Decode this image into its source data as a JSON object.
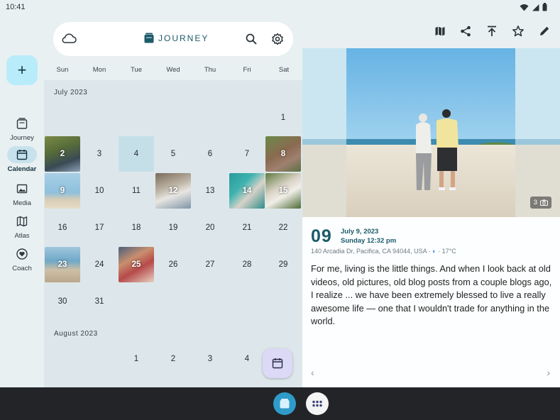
{
  "status": {
    "time": "10:41"
  },
  "rail": {
    "add_label": "+",
    "items": [
      {
        "label": "Journey",
        "icon": "journey-icon"
      },
      {
        "label": "Calendar",
        "icon": "calendar-icon",
        "active": true
      },
      {
        "label": "Media",
        "icon": "media-icon"
      },
      {
        "label": "Atlas",
        "icon": "map-icon"
      },
      {
        "label": "Coach",
        "icon": "coach-icon"
      }
    ]
  },
  "search_bar": {
    "brand": "JOURNEY"
  },
  "weekdays": [
    "Sun",
    "Mon",
    "Tue",
    "Wed",
    "Thu",
    "Fri",
    "Sat"
  ],
  "calendar": {
    "july_label": "July 2023",
    "august_label": "August 2023",
    "july_days": [
      "1",
      "2",
      "3",
      "4",
      "5",
      "6",
      "7",
      "8",
      "9",
      "10",
      "11",
      "12",
      "13",
      "14",
      "15",
      "16",
      "17",
      "18",
      "19",
      "20",
      "21",
      "22",
      "23",
      "24",
      "25",
      "26",
      "27",
      "28",
      "29",
      "30",
      "31"
    ],
    "august_days": [
      "1",
      "2",
      "3",
      "4"
    ],
    "today": "4",
    "photo_days": [
      "2",
      "8",
      "9",
      "12",
      "14",
      "15",
      "23",
      "25"
    ]
  },
  "entry": {
    "day": "09",
    "date": "July 9, 2023",
    "weekday_time": "Sunday 12:32 pm",
    "location": "140 Arcadia Dr, Pacifica, CA 94044, USA",
    "weather": "17°C",
    "photo_count": "3",
    "body": "For me, living is the little things. And when I look back at old videos, old pictures, old blog posts from a couple blogs ago, I realize ... we have been extremely blessed to live a really awesome life — one that I wouldn't trade for anything in the world."
  },
  "colors": {
    "accent": "#1a5a6a",
    "fab": "#b9ecfa",
    "fab_secondary": "#dcd9f6"
  }
}
